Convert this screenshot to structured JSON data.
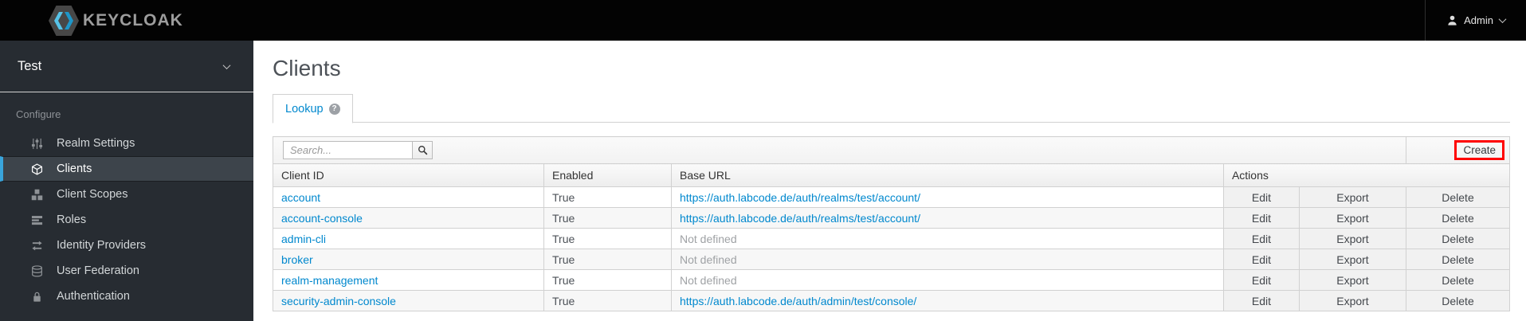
{
  "colors": {
    "topbar": "#030303",
    "sidebar": "#272c32",
    "accent": "#39a5dc",
    "link": "#0088ce",
    "highlight": "#ff0000"
  },
  "topbar": {
    "brand": "KEYCLOAK",
    "user": {
      "label": "Admin",
      "icon": "user-icon",
      "menu_icon": "chevron-down-icon"
    }
  },
  "sidebar": {
    "realm": "Test",
    "realm_icon": "chevron-down-icon",
    "section_label": "Configure",
    "items": [
      {
        "label": "Realm Settings",
        "icon": "sliders-icon",
        "active": false
      },
      {
        "label": "Clients",
        "icon": "cube-icon",
        "active": true
      },
      {
        "label": "Client Scopes",
        "icon": "cubes-icon",
        "active": false
      },
      {
        "label": "Roles",
        "icon": "list-icon",
        "active": false
      },
      {
        "label": "Identity Providers",
        "icon": "exchange-icon",
        "active": false
      },
      {
        "label": "User Federation",
        "icon": "database-icon",
        "active": false
      },
      {
        "label": "Authentication",
        "icon": "lock-icon",
        "active": false
      }
    ]
  },
  "main": {
    "title": "Clients",
    "tabs": [
      {
        "label": "Lookup",
        "active": true,
        "help_icon": "question-circle-icon"
      }
    ],
    "toolbar": {
      "search_placeholder": "Search...",
      "search_icon": "search-icon",
      "create_label": "Create"
    },
    "table": {
      "columns": [
        "Client ID",
        "Enabled",
        "Base URL",
        "Actions"
      ],
      "action_labels": [
        "Edit",
        "Export",
        "Delete"
      ],
      "rows": [
        {
          "client_id": "account",
          "enabled": "True",
          "base_url": "https://auth.labcode.de/auth/realms/test/account/",
          "base_url_defined": true
        },
        {
          "client_id": "account-console",
          "enabled": "True",
          "base_url": "https://auth.labcode.de/auth/realms/test/account/",
          "base_url_defined": true
        },
        {
          "client_id": "admin-cli",
          "enabled": "True",
          "base_url": "Not defined",
          "base_url_defined": false
        },
        {
          "client_id": "broker",
          "enabled": "True",
          "base_url": "Not defined",
          "base_url_defined": false
        },
        {
          "client_id": "realm-management",
          "enabled": "True",
          "base_url": "Not defined",
          "base_url_defined": false
        },
        {
          "client_id": "security-admin-console",
          "enabled": "True",
          "base_url": "https://auth.labcode.de/auth/admin/test/console/",
          "base_url_defined": true
        }
      ]
    }
  }
}
